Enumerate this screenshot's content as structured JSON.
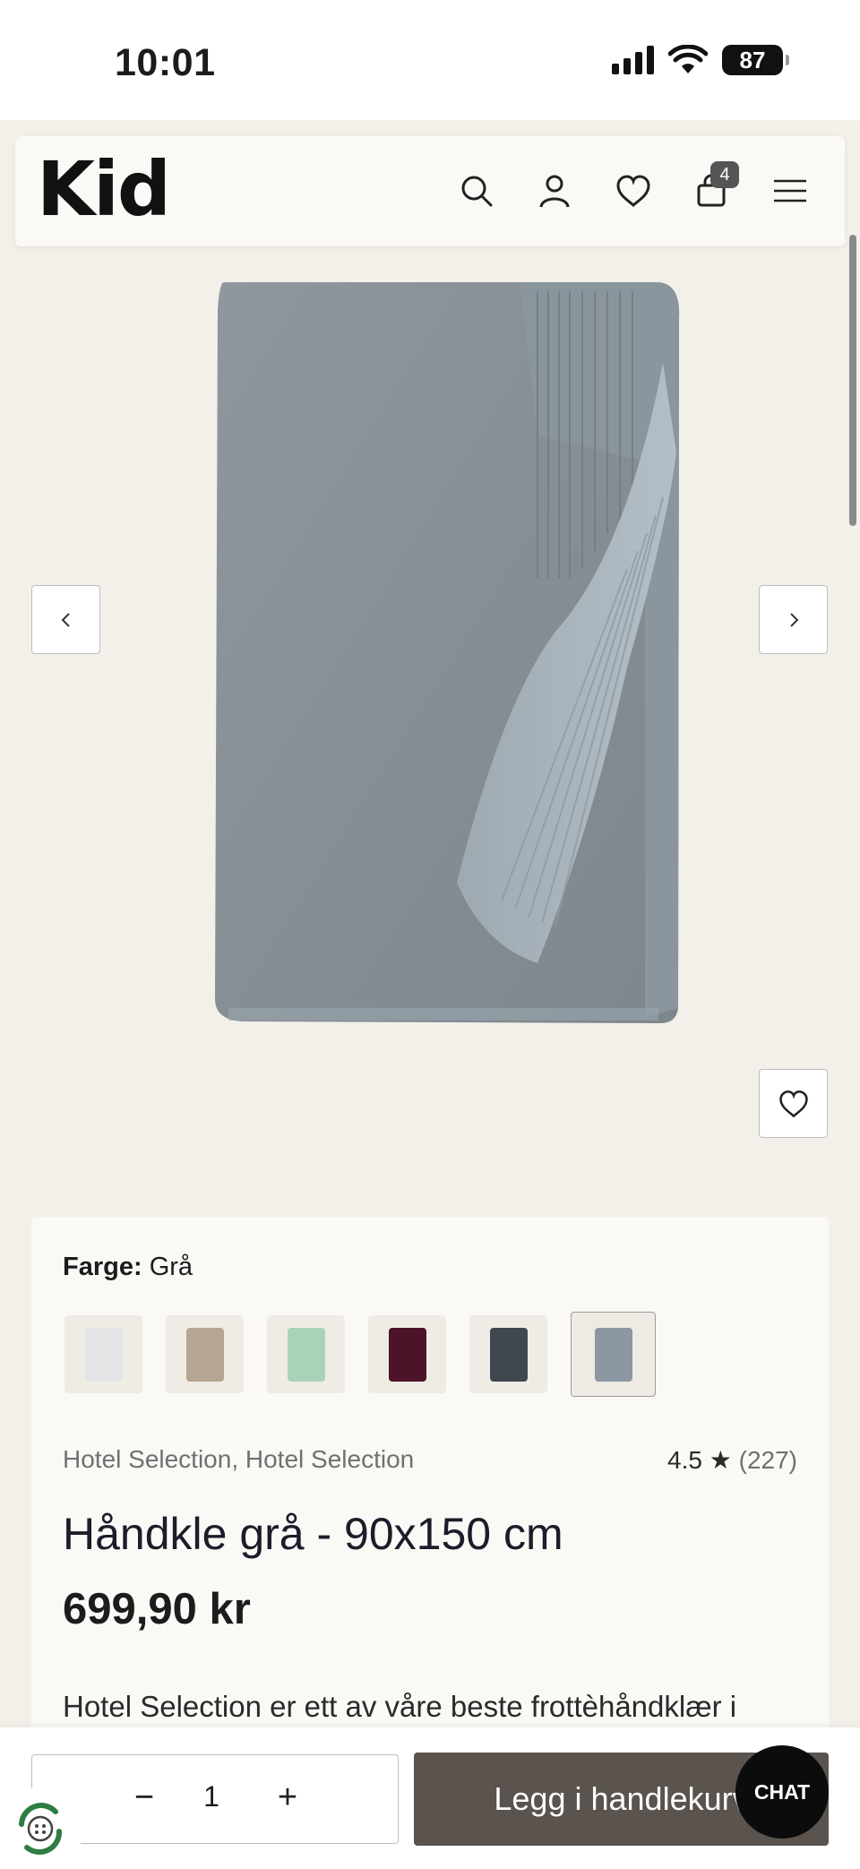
{
  "status": {
    "time": "10:01",
    "battery": "87"
  },
  "header": {
    "logo": "Kid",
    "cart_count": "4"
  },
  "gallery": {
    "product_image": "grey-towel-image"
  },
  "product": {
    "color_label": "Farge:",
    "color_value": "Grå",
    "swatches": [
      {
        "name": "white",
        "color": "#e4e5e6"
      },
      {
        "name": "beige",
        "color": "#b5a591"
      },
      {
        "name": "mint",
        "color": "#a8d3b8"
      },
      {
        "name": "burgundy",
        "color": "#4d1328"
      },
      {
        "name": "navy",
        "color": "#40474f"
      },
      {
        "name": "grey",
        "color": "#8c97a1",
        "selected": true
      }
    ],
    "brand": "Hotel Selection, Hotel Selection",
    "rating": "4.5",
    "rating_star": "★",
    "review_count": "(227)",
    "title": "Håndkle grå - 90x150 cm",
    "price": "699,90 kr",
    "description": "Hotel Selection er ett av våre beste frottèhåndklær i"
  },
  "cart_bar": {
    "minus": "−",
    "quantity": "1",
    "plus": "+",
    "add_label": "Legg i handlekurv",
    "chat_label": "CHAT"
  },
  "colors": {
    "accent_button": "#5a534e",
    "background": "#f3f0ea"
  }
}
